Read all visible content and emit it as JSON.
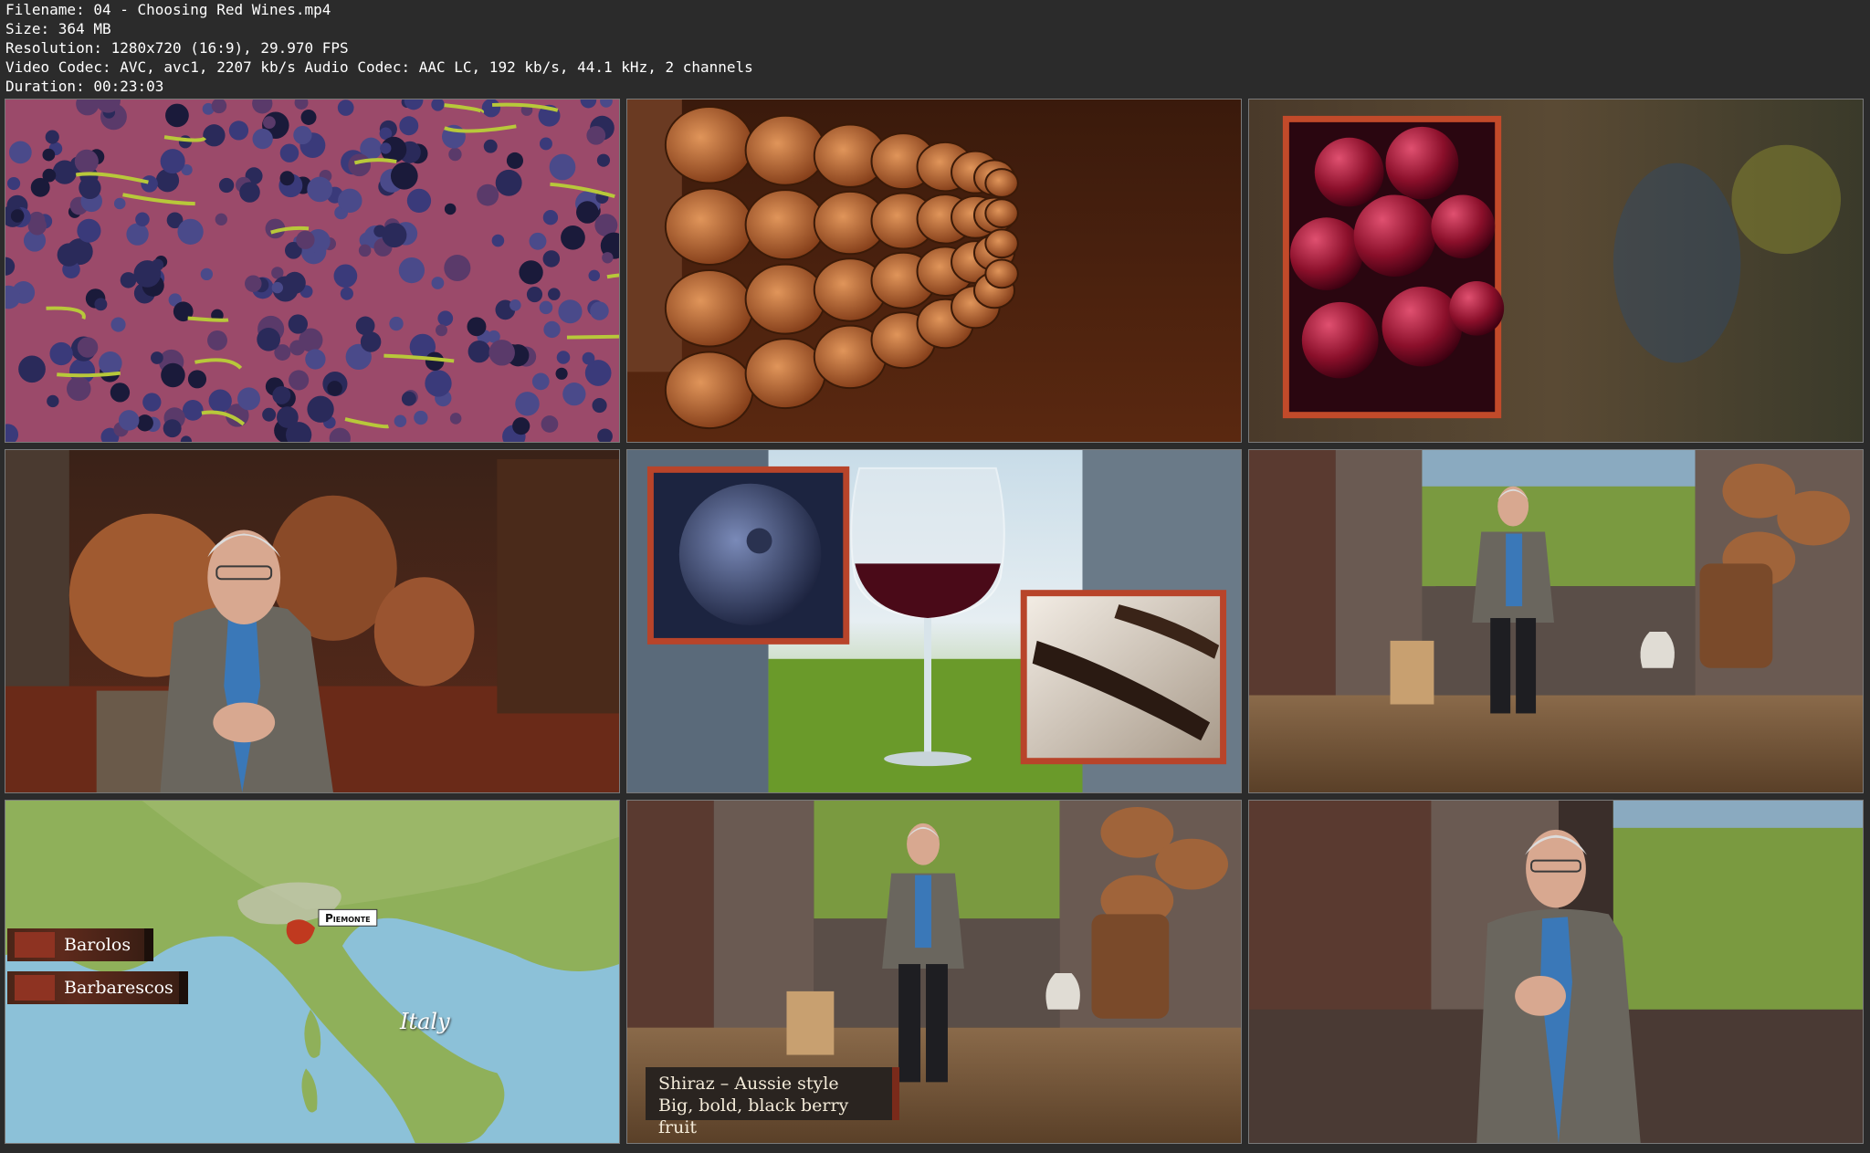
{
  "file_info": {
    "filename": "Filename: 04 - Choosing Red Wines.mp4",
    "size": "Size: 364 MB",
    "resolution": "Resolution: 1280x720 (16:9), 29.970 FPS",
    "codec": "Video Codec: AVC, avc1, 2207 kb/s Audio Codec: AAC LC, 192 kb/s, 44.1 kHz, 2 channels",
    "duration": "Duration: 00:23:03"
  },
  "thumbnails": [
    {
      "id": 1,
      "scene": "grape-crush"
    },
    {
      "id": 2,
      "scene": "barrel-cellar"
    },
    {
      "id": 3,
      "scene": "cherries"
    },
    {
      "id": 4,
      "scene": "presenter-cellar"
    },
    {
      "id": 5,
      "scene": "wine-glass-collage"
    },
    {
      "id": 6,
      "scene": "presenter-studio-wide"
    },
    {
      "id": 7,
      "scene": "italy-map"
    },
    {
      "id": 8,
      "scene": "presenter-studio-caption"
    },
    {
      "id": 9,
      "scene": "presenter-studio-close"
    }
  ],
  "map": {
    "region_label": "Piemonte",
    "country_label": "Italy",
    "legend": [
      "Barolos",
      "Barbarescos"
    ]
  },
  "caption": {
    "line1": "Shiraz – Aussie style",
    "line2": "Big, bold, black berry fruit"
  },
  "colors": {
    "background": "#2b2b2b",
    "caption_bg": "#2a2420",
    "map_land": "#8fb05a",
    "map_sea": "#8cc1d8",
    "region_red": "#c0391f"
  }
}
